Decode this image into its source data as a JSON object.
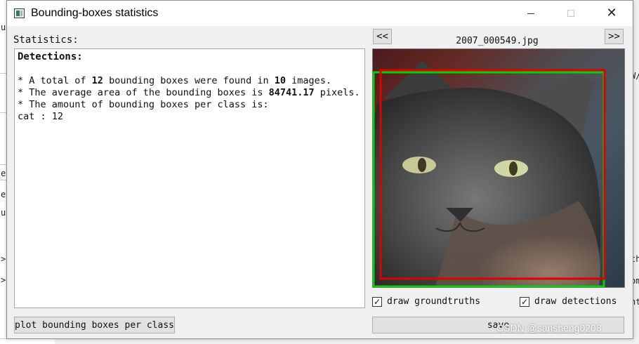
{
  "window": {
    "title": "Bounding-boxes statistics"
  },
  "controls": {
    "minimize": "—",
    "maximize": "□",
    "close": "✕"
  },
  "statistics": {
    "label": "Statistics:",
    "heading": "Detections:",
    "line1_prefix": "* A total of ",
    "line1_count": "12",
    "line1_middle": " bounding boxes were found in ",
    "line1_images": "10",
    "line1_suffix": " images.",
    "line2_prefix": "* The average area of the bounding boxes is ",
    "line2_area": "84741.17",
    "line2_suffix": " pixels.",
    "line3": "* The amount of bounding boxes per class is:",
    "class_line": "cat : 12"
  },
  "viewer": {
    "prev": "<<",
    "next": ">>",
    "filename": "2007_000549.jpg",
    "draw_groundtruths_label": "draw groundtruths",
    "draw_detections_label": "draw detections",
    "draw_groundtruths_checked": true,
    "draw_detections_checked": true,
    "groundtruth_box_color": "#00d400",
    "detection_box_color": "#e00000"
  },
  "buttons": {
    "plot": "plot bounding boxes per class",
    "save": "save"
  },
  "watermark": "CSDN @sansheng0208",
  "backdrop": {
    "left_edge": [
      "u",
      "e",
      "e",
      "u",
      ">",
      ">"
    ],
    "right_edge": [
      "W/",
      "th",
      "om",
      "nt"
    ]
  }
}
